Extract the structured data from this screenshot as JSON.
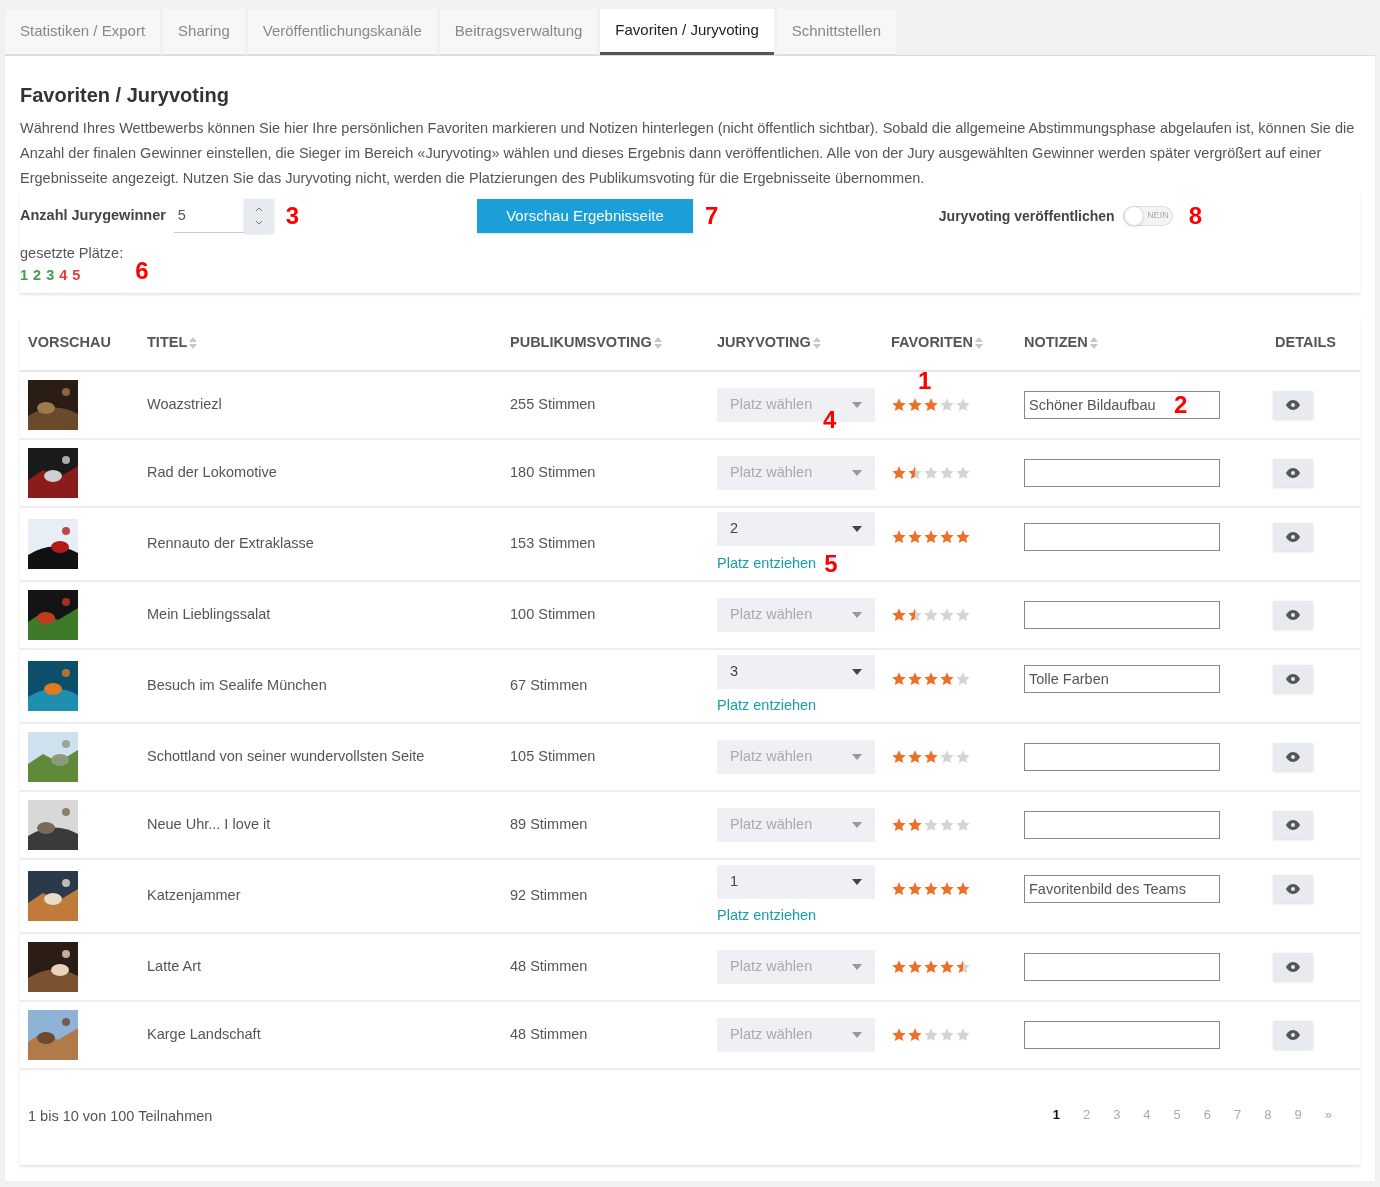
{
  "tabs": [
    {
      "label": "Statistiken / Export",
      "selected": false
    },
    {
      "label": "Sharing",
      "selected": false
    },
    {
      "label": "Veröffentlichungskanäle",
      "selected": false
    },
    {
      "label": "Beitragsverwaltung",
      "selected": false
    },
    {
      "label": "Favoriten / Juryvoting",
      "selected": true
    },
    {
      "label": "Schnittstellen",
      "selected": false
    }
  ],
  "heading": "Favoriten / Juryvoting",
  "intro": "Während Ihres Wettbewerbs können Sie hier Ihre persönlichen Favoriten markieren und Notizen hinterlegen (nicht öffentlich sichtbar). Sobald die allgemeine Abstimmungsphase abgelaufen ist, können Sie die Anzahl der finalen Gewinner einstellen, die Sieger im Bereich «Juryvoting» wählen und dieses Ergebnis dann veröffentlichen. Alle von der Jury ausgewählten Gewinner werden später vergrößert auf einer Ergebnisseite angezeigt. Nutzen Sie das Juryvoting nicht, werden die Platzierungen des Publikumsvoting für die Ergebnisseite übernommen.",
  "winners": {
    "label": "Anzahl Jurygewinner",
    "value": "5",
    "callout": "3"
  },
  "preview_button": {
    "label": "Vorschau Ergebnisseite",
    "callout": "7"
  },
  "publish": {
    "label": "Juryvoting veröffentlichen",
    "on": false,
    "toggle_text": "NEIN",
    "callout": "8"
  },
  "places": {
    "label": "gesetzte Plätze:",
    "callout": "6",
    "items": [
      {
        "text": "1",
        "color": "#43a047"
      },
      {
        "text": "2",
        "color": "#43a047"
      },
      {
        "text": "3",
        "color": "#43a047"
      },
      {
        "text": "4",
        "color": "#e53935"
      },
      {
        "text": "5",
        "color": "#e53935"
      }
    ]
  },
  "columns": [
    {
      "label": "VORSCHAU",
      "sortable": false
    },
    {
      "label": "TITEL",
      "sortable": true
    },
    {
      "label": "PUBLIKUMSVOTING",
      "sortable": true
    },
    {
      "label": "JURYVOTING",
      "sortable": true
    },
    {
      "label": "FAVORITEN",
      "sortable": true
    },
    {
      "label": "NOTIZEN",
      "sortable": true
    },
    {
      "label": "DETAILS",
      "sortable": false
    }
  ],
  "rows": [
    {
      "title": "Woazstriezl",
      "votes": "255 Stimmen",
      "jury": {
        "placeholder": "Platz wählen",
        "callout": "4"
      },
      "stars": 3,
      "stars_callout": "1",
      "note": "Schöner Bildaufbau",
      "note_callout": "2"
    },
    {
      "title": "Rad der Lokomotive",
      "votes": "180 Stimmen",
      "jury": {
        "placeholder": "Platz wählen"
      },
      "stars": 1.5,
      "note": ""
    },
    {
      "title": "Rennauto der Extraklasse",
      "votes": "153 Stimmen",
      "jury": {
        "value": "2",
        "link": "Platz entziehen",
        "callout": "5"
      },
      "stars": 5,
      "note": ""
    },
    {
      "title": "Mein Lieblingssalat",
      "votes": "100 Stimmen",
      "jury": {
        "placeholder": "Platz wählen"
      },
      "stars": 1.5,
      "note": ""
    },
    {
      "title": "Besuch im Sealife München",
      "votes": "67 Stimmen",
      "jury": {
        "value": "3",
        "link": "Platz entziehen"
      },
      "stars": 4,
      "note": "Tolle Farben"
    },
    {
      "title": "Schottland von seiner wundervollsten Seite",
      "votes": "105 Stimmen",
      "jury": {
        "placeholder": "Platz wählen"
      },
      "stars": 3,
      "note": ""
    },
    {
      "title": "Neue Uhr... I love it",
      "votes": "89 Stimmen",
      "jury": {
        "placeholder": "Platz wählen"
      },
      "stars": 2,
      "note": ""
    },
    {
      "title": "Katzenjammer",
      "votes": "92 Stimmen",
      "jury": {
        "value": "1",
        "link": "Platz entziehen"
      },
      "stars": 5,
      "note": "Favoritenbild des Teams"
    },
    {
      "title": "Latte Art",
      "votes": "48 Stimmen",
      "jury": {
        "placeholder": "Platz wählen"
      },
      "stars": 4.5,
      "note": ""
    },
    {
      "title": "Karge Landschaft",
      "votes": "48 Stimmen",
      "jury": {
        "placeholder": "Platz wählen"
      },
      "stars": 2,
      "note": ""
    }
  ],
  "footer": {
    "summary": "1 bis 10 von 100 Teilnahmen",
    "pages": [
      {
        "label": "1",
        "selected": true
      },
      {
        "label": "2",
        "selected": false
      },
      {
        "label": "3",
        "selected": false
      },
      {
        "label": "4",
        "selected": false
      },
      {
        "label": "5",
        "selected": false
      },
      {
        "label": "6",
        "selected": false
      },
      {
        "label": "7",
        "selected": false
      },
      {
        "label": "8",
        "selected": false
      },
      {
        "label": "9",
        "selected": false
      },
      {
        "label": "»",
        "selected": false
      }
    ]
  }
}
